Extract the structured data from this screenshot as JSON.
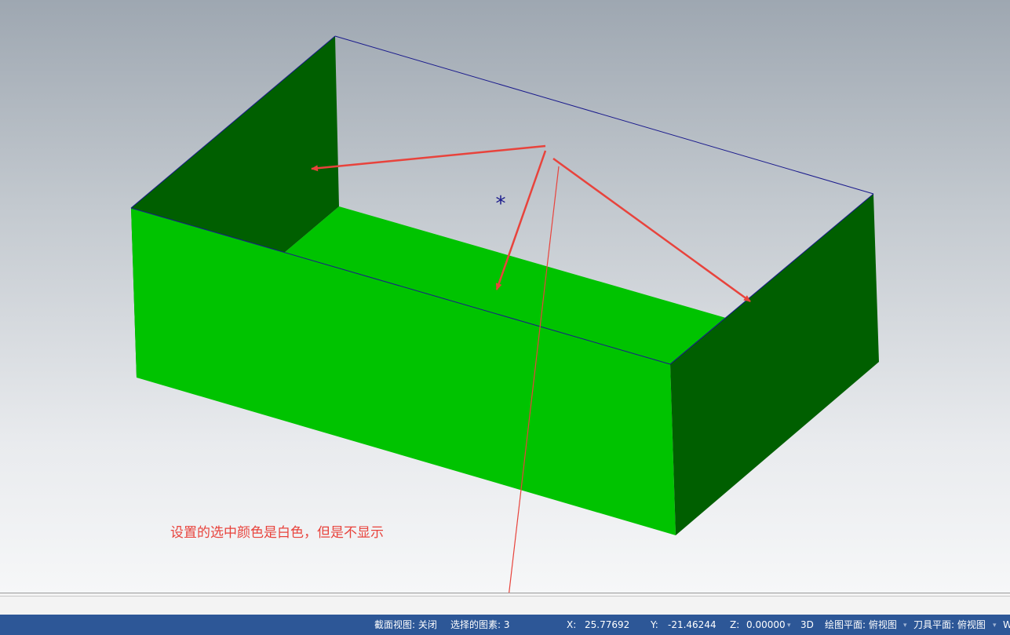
{
  "annotation": {
    "text": "设置的选中颜色是白色，但是不显示",
    "color": "#e8433c"
  },
  "model": {
    "side_face_color": "#005f00",
    "bottom_face_color": "#00c300",
    "edge_color": "#1a1a8c",
    "origin_marker": "*"
  },
  "statusbar": {
    "section_view": "截面视图: 关闭",
    "selected_entities": "选择的图素: 3",
    "x_label": "X:",
    "x_value": "25.77692",
    "y_label": "Y:",
    "y_value": "-21.46244",
    "z_label": "Z:",
    "z_value": "0.00000",
    "mode": "3D",
    "drawing_plane": "绘图平面: 俯视图",
    "tool_plane": "刀具平面: 俯视图",
    "wcs": "W",
    "dropdown_icon": "caret-down"
  }
}
